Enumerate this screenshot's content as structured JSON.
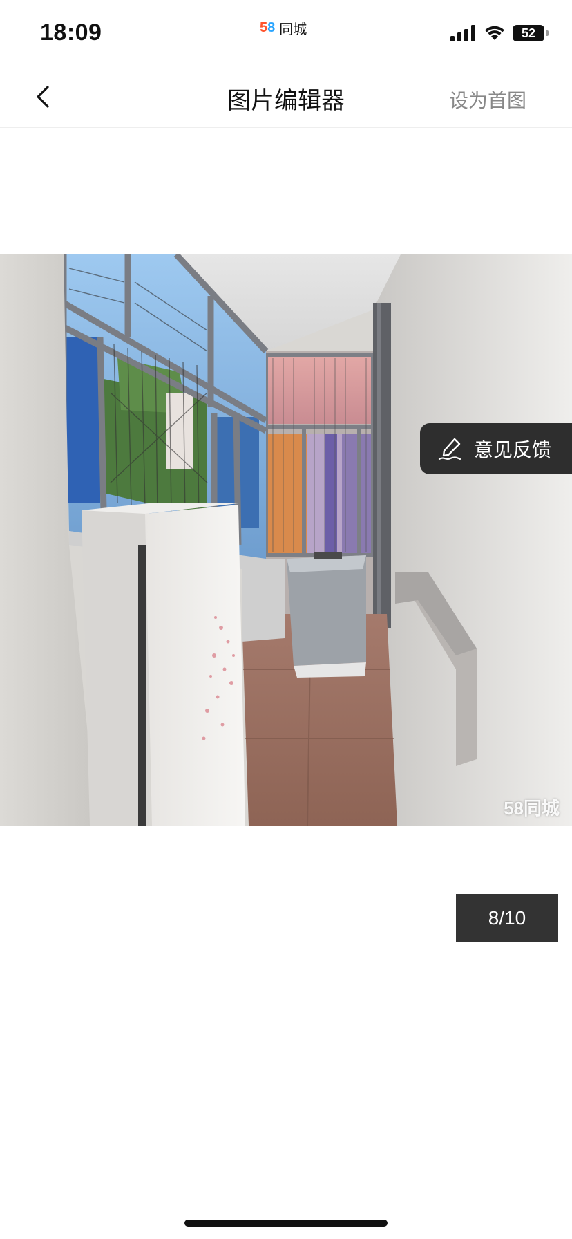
{
  "status_bar": {
    "time": "18:09",
    "app_logo_text": "58",
    "app_name": "同城",
    "battery": "52"
  },
  "nav": {
    "title": "图片编辑器",
    "set_cover_label": "设为首图"
  },
  "photo": {
    "watermark": "58同城"
  },
  "feedback": {
    "label": "意见反馈",
    "icon": "pen-icon"
  },
  "pager": {
    "text": "8/10"
  },
  "colors": {
    "feedback_bg": "#2e2e2e",
    "counter_bg": "#333333",
    "set_cover_text": "#888888",
    "logo_red": "#ff552e",
    "logo_blue": "#2aa5ff"
  }
}
